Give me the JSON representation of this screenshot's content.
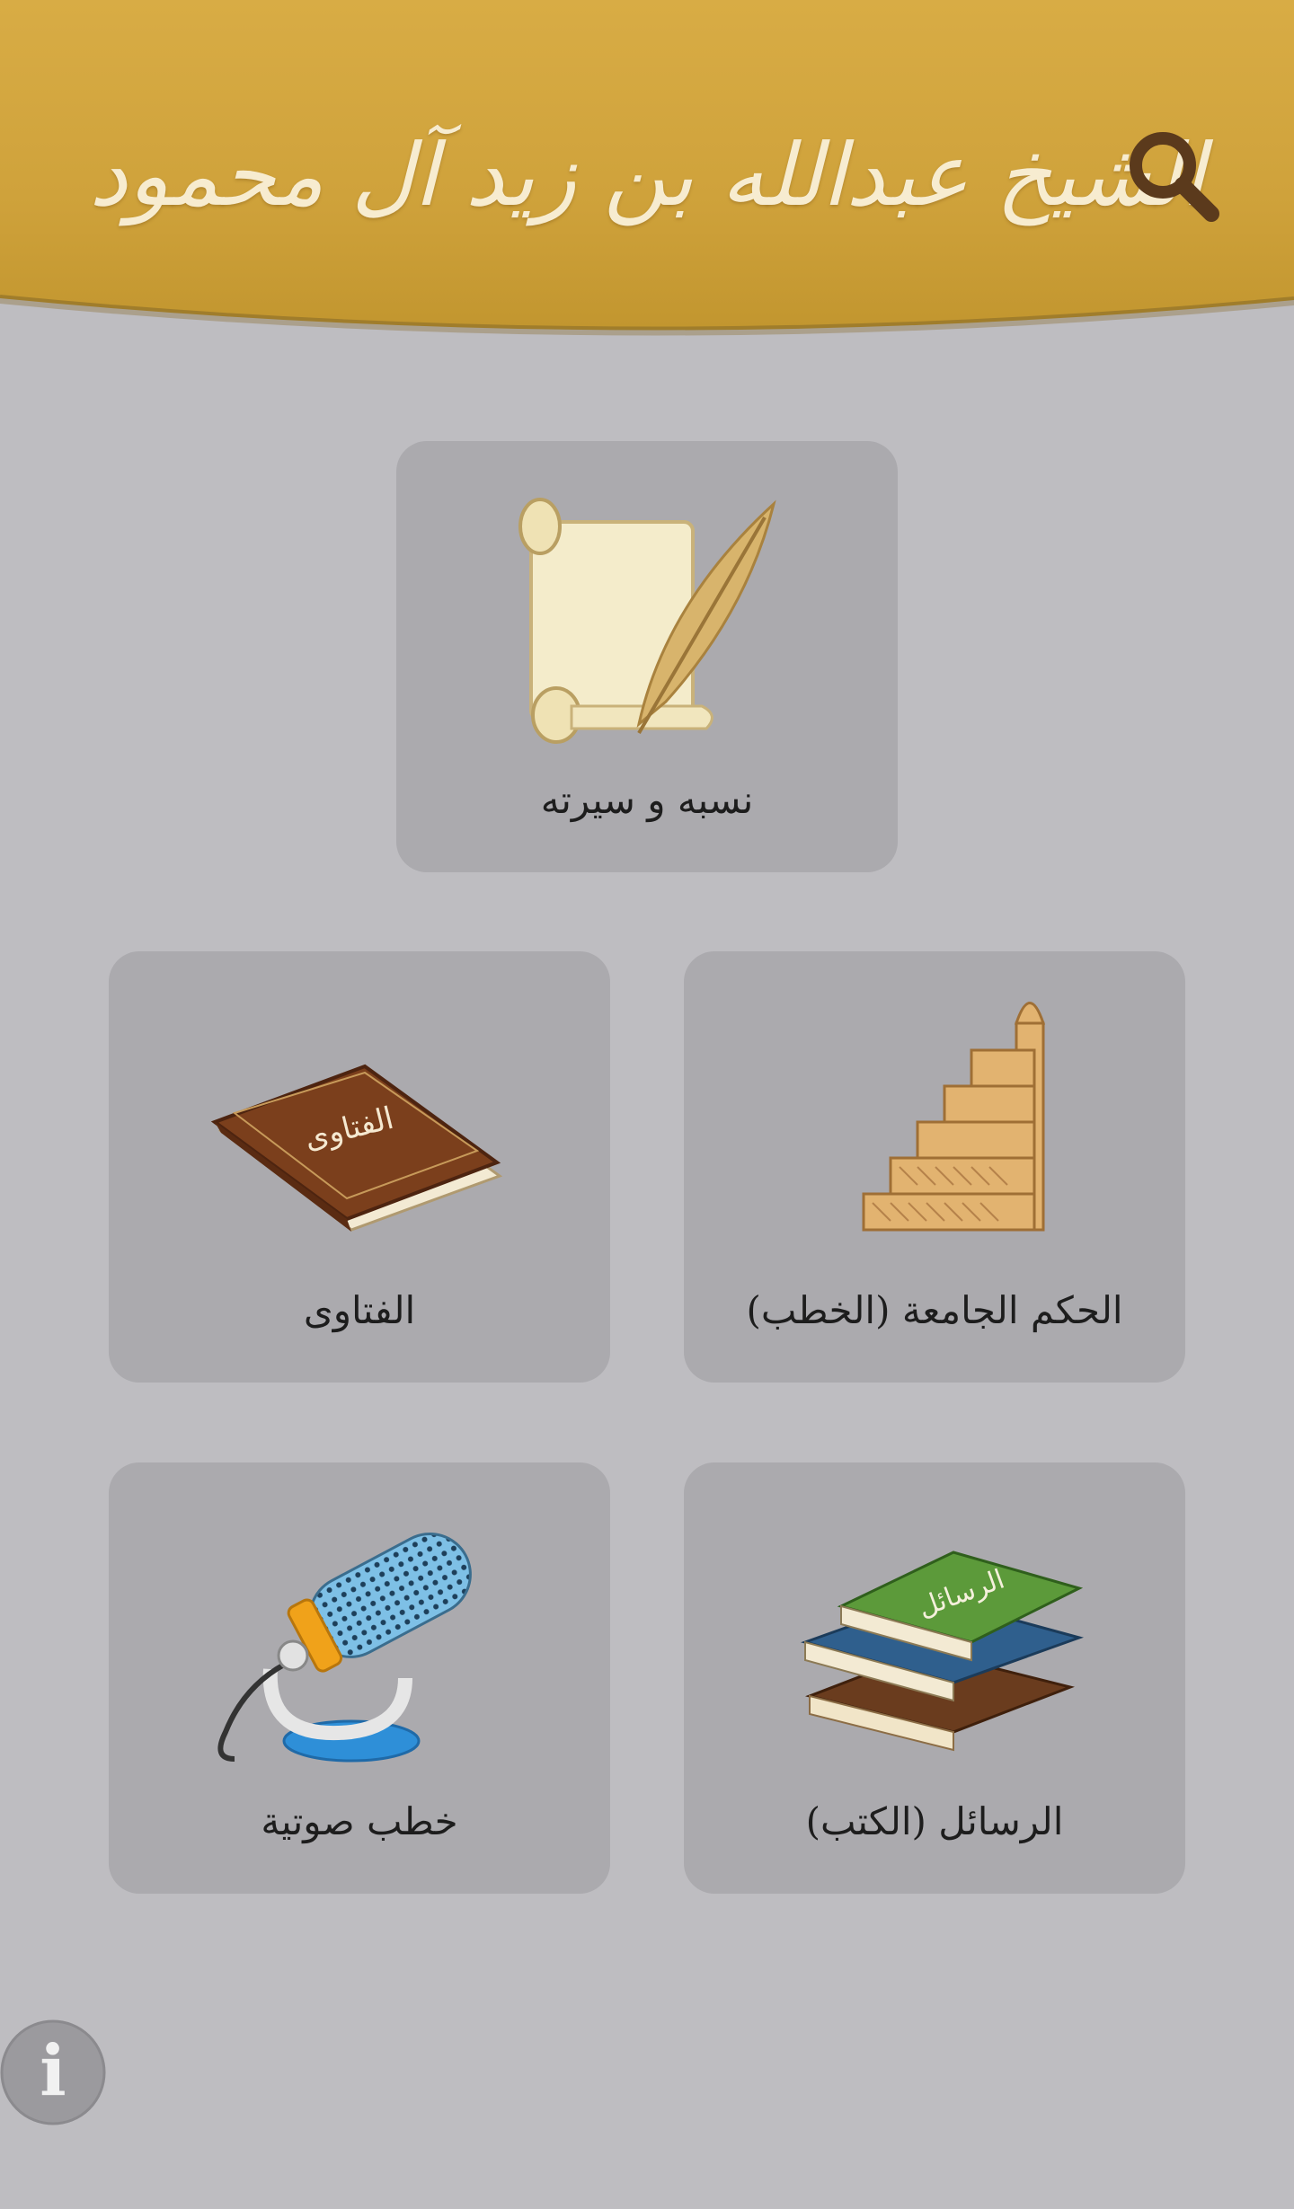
{
  "header": {
    "title": "الشيخ عبدالله بن زيد آل محمود",
    "search_icon": "search-icon",
    "colors": {
      "gold": "#d1a53f",
      "gold_dark": "#b98a2a",
      "icon_brown": "#5b3a1c"
    }
  },
  "tiles": [
    {
      "label": "نسبه و سيرته",
      "icon": "scroll-quill-icon"
    },
    {
      "label": "الحكم الجامعة (الخطب)",
      "icon": "minbar-icon"
    },
    {
      "label": "الفتاوى",
      "icon": "fatawa-book-icon",
      "book_text": "الفتاوى"
    },
    {
      "label": "الرسائل (الكتب)",
      "icon": "books-stack-icon",
      "book_text": "الرسائل"
    },
    {
      "label": "خطب صوتية",
      "icon": "microphone-icon"
    }
  ],
  "footer": {
    "info_icon": "info-icon",
    "info_symbol": "i"
  },
  "colors": {
    "background": "#bebdc1",
    "tile": "#abaaae"
  }
}
